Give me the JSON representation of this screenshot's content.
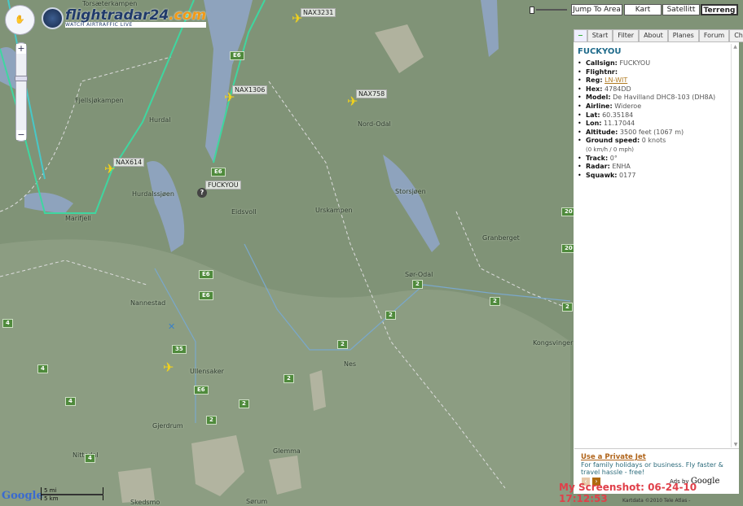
{
  "logo": {
    "name_a": "flight",
    "name_b": "radar24",
    "name_c": ".com",
    "slogan": "WATCH AIRTRAFFIC LIVE"
  },
  "map_controls": {
    "zoom_in": "+",
    "zoom_out": "−",
    "pan_icon": "hand-icon"
  },
  "map_types": {
    "jump": "Jump To Area",
    "kart": "Kart",
    "satellite": "Satellitt",
    "terrain": "Terreng",
    "selected": "Terreng"
  },
  "tabs": [
    "Start",
    "Filter",
    "About",
    "Planes",
    "Forum",
    "Chat"
  ],
  "flight": {
    "title": "FUCKYOU",
    "fields": [
      {
        "label": "Callsign:",
        "value": "FUCKYOU"
      },
      {
        "label": "Flightnr:",
        "value": ""
      },
      {
        "label": "Reg:",
        "value": "LN-WIT"
      },
      {
        "label": "Hex:",
        "value": "4784DD"
      },
      {
        "label": "Model:",
        "value": "De Havilland DHC8-103 (DH8A)"
      },
      {
        "label": "Airline:",
        "value": "Wideroe"
      },
      {
        "label": "Lat:",
        "value": "60.35184"
      },
      {
        "label": "Lon:",
        "value": "11.17044"
      },
      {
        "label": "Altitude:",
        "value": "3500 feet (1067 m)"
      },
      {
        "label": "Ground speed:",
        "value": "0 knots",
        "sub": "(0 km/h / 0 mph)"
      },
      {
        "label": "Track:",
        "value": "0°"
      },
      {
        "label": "Radar:",
        "value": "ENHA"
      },
      {
        "label": "Squawk:",
        "value": "0177"
      }
    ]
  },
  "ad": {
    "headline": "Use a Private Jet",
    "body": "For family holidays or business. Fly faster & travel hassle - free!",
    "ads_by": "Ads by",
    "google": "Google"
  },
  "watermark": "My Screenshot: 06-24-10 17:12:53",
  "credit": "Kartdata ©2010 Tele Atlas -",
  "scale": {
    "mi": "5 mi",
    "km": "5 km"
  },
  "google_logo": "Google",
  "planes": [
    "NAX3231",
    "NAX1306",
    "NAX758",
    "NAX614",
    "FUCKYOU"
  ],
  "places": [
    "Torsæterkampen",
    "Fjellsjøkampen",
    "Hurdal",
    "Hurdalssjøen",
    "Marifjell",
    "Eidsvoll",
    "Nord-Odal",
    "Storsjøen",
    "Urskampen",
    "Granberget",
    "Sør-Odal",
    "Nannestad",
    "Ullensaker",
    "Nes",
    "Kongsvinger",
    "Gjerdrum",
    "Nittedal",
    "Glemma",
    "Sørum",
    "Skedsmo"
  ],
  "roads": [
    "E6",
    "E6",
    "E6",
    "E6",
    "E6",
    "2",
    "2",
    "2",
    "2",
    "2",
    "2",
    "2",
    "2",
    "35",
    "4",
    "4",
    "4",
    "4",
    "20",
    "20"
  ],
  "colors": {
    "track": "#3fd6a0",
    "terrain": "#809377",
    "water": "#8ea3bd",
    "accent": "#1e6a8a"
  }
}
